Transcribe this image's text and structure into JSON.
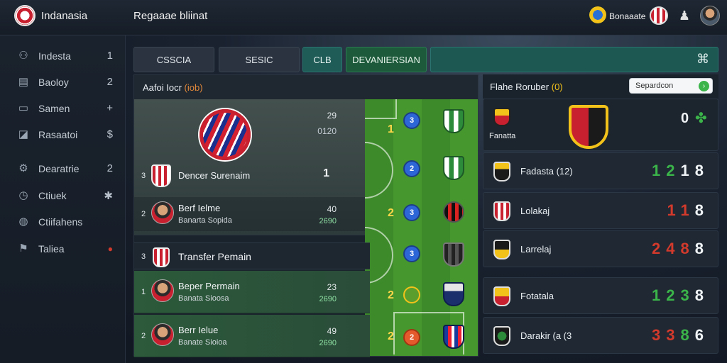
{
  "header": {
    "brand": "Indanasia",
    "screen_title": "Regaaae bliinat",
    "user": "Bonaaate"
  },
  "sidebar": {
    "items": [
      {
        "label": "Indesta",
        "count": "1",
        "icon": "gamepad-icon"
      },
      {
        "label": "Baoloy",
        "count": "2",
        "icon": "table-icon"
      },
      {
        "label": "Samen",
        "count": "+",
        "icon": "book-icon"
      },
      {
        "label": "Rasaatoi",
        "count": "$",
        "icon": "chart-icon"
      },
      {
        "label": "Dearatrie",
        "count": "2",
        "icon": "gear-icon"
      },
      {
        "label": "Ctiuek",
        "count": "✱",
        "icon": "clock-icon"
      },
      {
        "label": "Ctiifahens",
        "count": "",
        "icon": "globe-icon"
      },
      {
        "label": "Taliea",
        "count": "●",
        "icon": "flag-icon"
      }
    ]
  },
  "tabs": [
    "CSSCIA",
    "SESIC",
    "CLB",
    "DEVANIERSIAN"
  ],
  "left_panel": {
    "title": "Aafoi Iocr",
    "title_suffix": "(iob)",
    "featured": {
      "meta1": "29",
      "meta2": "0120",
      "row_num": "3",
      "row_name": "Dencer Surenaim",
      "row_value": "1"
    },
    "player2": {
      "num": "2",
      "name": "Berf Ielme",
      "sub": "Banarta   Sopida",
      "v1": "40",
      "v2": "2690"
    },
    "transfer_head": {
      "num": "3",
      "title": "Transfer Pemain"
    },
    "transfers": [
      {
        "num": "1",
        "name": "Beper Permain",
        "sub": "Banata   Sioosa",
        "v1": "23",
        "v2": "2690"
      },
      {
        "num": "2",
        "name": "Berr Ielue",
        "sub": "Banate   Sioioa",
        "v1": "49",
        "v2": "2690"
      }
    ],
    "pitch": {
      "marks": [
        "3",
        "2",
        "3",
        "3",
        "",
        "2"
      ],
      "nums": [
        "1",
        "2",
        "2",
        "2"
      ]
    }
  },
  "right_panel": {
    "title": "Flahe Roruber",
    "title_suffix": "(0)",
    "search_placeholder": "Separdcon",
    "highlight": {
      "small_label": "Fanatta",
      "score": "0"
    },
    "results": [
      {
        "team": "Fadasta  (12)",
        "digits": [
          [
            "1",
            "g"
          ],
          [
            "2",
            "g"
          ],
          [
            "1",
            "w"
          ],
          [
            "8",
            "w"
          ]
        ]
      },
      {
        "team": "Lolakaj",
        "digits": [
          [
            "1",
            "r"
          ],
          [
            "1",
            "r"
          ],
          [
            "8",
            "w"
          ]
        ]
      },
      {
        "team": "Larrelaj",
        "digits": [
          [
            "2",
            "r"
          ],
          [
            "4",
            "r"
          ],
          [
            "8",
            "r"
          ],
          [
            "8",
            "w"
          ]
        ]
      },
      {
        "team": "Fotatala",
        "digits": [
          [
            "1",
            "g"
          ],
          [
            "2",
            "g"
          ],
          [
            "3",
            "g"
          ],
          [
            "8",
            "w"
          ]
        ]
      },
      {
        "team": "Darakir (a  (3",
        "digits": [
          [
            "3",
            "r"
          ],
          [
            "3",
            "r"
          ],
          [
            "8",
            "g"
          ],
          [
            "6",
            "w"
          ]
        ]
      }
    ]
  },
  "colors": {
    "accent_green": "#3bb54a",
    "accent_red": "#d33a2c",
    "accent_yellow": "#f2c21a",
    "teal_tab": "#1f5b57"
  }
}
